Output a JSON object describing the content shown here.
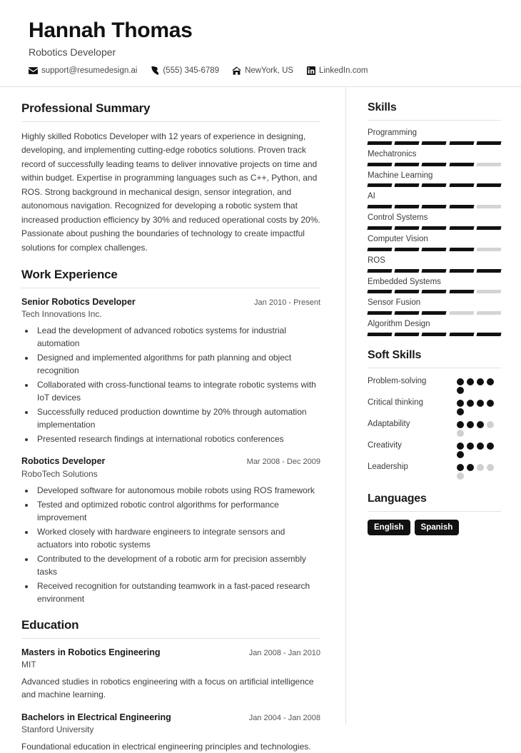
{
  "header": {
    "name": "Hannah Thomas",
    "role": "Robotics Developer",
    "contacts": [
      {
        "icon": "envelope-icon",
        "text": "support@resumedesign.ai"
      },
      {
        "icon": "phone-icon",
        "text": "(555) 345-6789"
      },
      {
        "icon": "home-icon",
        "text": "NewYork, US"
      },
      {
        "icon": "linkedin-icon",
        "text": "LinkedIn.com"
      }
    ]
  },
  "main": {
    "summary": {
      "title": "Professional Summary",
      "text": "Highly skilled Robotics Developer with 12 years of experience in designing, developing, and implementing cutting-edge robotics solutions. Proven track record of successfully leading teams to deliver innovative projects on time and within budget. Expertise in programming languages such as C++, Python, and ROS. Strong background in mechanical design, sensor integration, and autonomous navigation. Recognized for developing a robotic system that increased production efficiency by 30% and reduced operational costs by 20%. Passionate about pushing the boundaries of technology to create impactful solutions for complex challenges."
    },
    "experience": {
      "title": "Work Experience",
      "entries": [
        {
          "title": "Senior Robotics Developer",
          "date": "Jan 2010 - Present",
          "org": "Tech Innovations Inc.",
          "bullets": [
            "Lead the development of advanced robotics systems for industrial automation",
            "Designed and implemented algorithms for path planning and object recognition",
            "Collaborated with cross-functional teams to integrate robotic systems with IoT devices",
            "Successfully reduced production downtime by 20% through automation implementation",
            "Presented research findings at international robotics conferences"
          ]
        },
        {
          "title": "Robotics Developer",
          "date": "Mar 2008 - Dec 2009",
          "org": "RoboTech Solutions",
          "bullets": [
            "Developed software for autonomous mobile robots using ROS framework",
            "Tested and optimized robotic control algorithms for performance improvement",
            "Worked closely with hardware engineers to integrate sensors and actuators into robotic systems",
            "Contributed to the development of a robotic arm for precision assembly tasks",
            "Received recognition for outstanding teamwork in a fast-paced research environment"
          ]
        }
      ]
    },
    "education": {
      "title": "Education",
      "entries": [
        {
          "title": "Masters in Robotics Engineering",
          "date": "Jan 2008 - Jan 2010",
          "org": "MIT",
          "description": "Advanced studies in robotics engineering with a focus on artificial intelligence and machine learning."
        },
        {
          "title": "Bachelors in Electrical Engineering",
          "date": "Jan 2004 - Jan 2008",
          "org": "Stanford University",
          "description": "Foundational education in electrical engineering principles and technologies."
        }
      ]
    }
  },
  "sidebar": {
    "skills": {
      "title": "Skills",
      "max": 5,
      "items": [
        {
          "name": "Programming",
          "level": 5
        },
        {
          "name": "Mechatronics",
          "level": 4
        },
        {
          "name": "Machine Learning",
          "level": 5
        },
        {
          "name": "AI",
          "level": 4
        },
        {
          "name": "Control Systems",
          "level": 5
        },
        {
          "name": "Computer Vision",
          "level": 4
        },
        {
          "name": "ROS",
          "level": 5
        },
        {
          "name": "Embedded Systems",
          "level": 4
        },
        {
          "name": "Sensor Fusion",
          "level": 3
        },
        {
          "name": "Algorithm Design",
          "level": 5
        }
      ]
    },
    "soft_skills": {
      "title": "Soft Skills",
      "max": 5,
      "items": [
        {
          "name": "Problem-solving",
          "level": 5
        },
        {
          "name": "Critical thinking",
          "level": 5
        },
        {
          "name": "Adaptability",
          "level": 3
        },
        {
          "name": "Creativity",
          "level": 5
        },
        {
          "name": "Leadership",
          "level": 2
        }
      ]
    },
    "languages": {
      "title": "Languages",
      "items": [
        "English",
        "Spanish"
      ]
    }
  },
  "colors": {
    "accent": "#111111",
    "text": "#3a3a3a",
    "muted": "#d0d0d0",
    "rule": "#e2e2e2"
  }
}
